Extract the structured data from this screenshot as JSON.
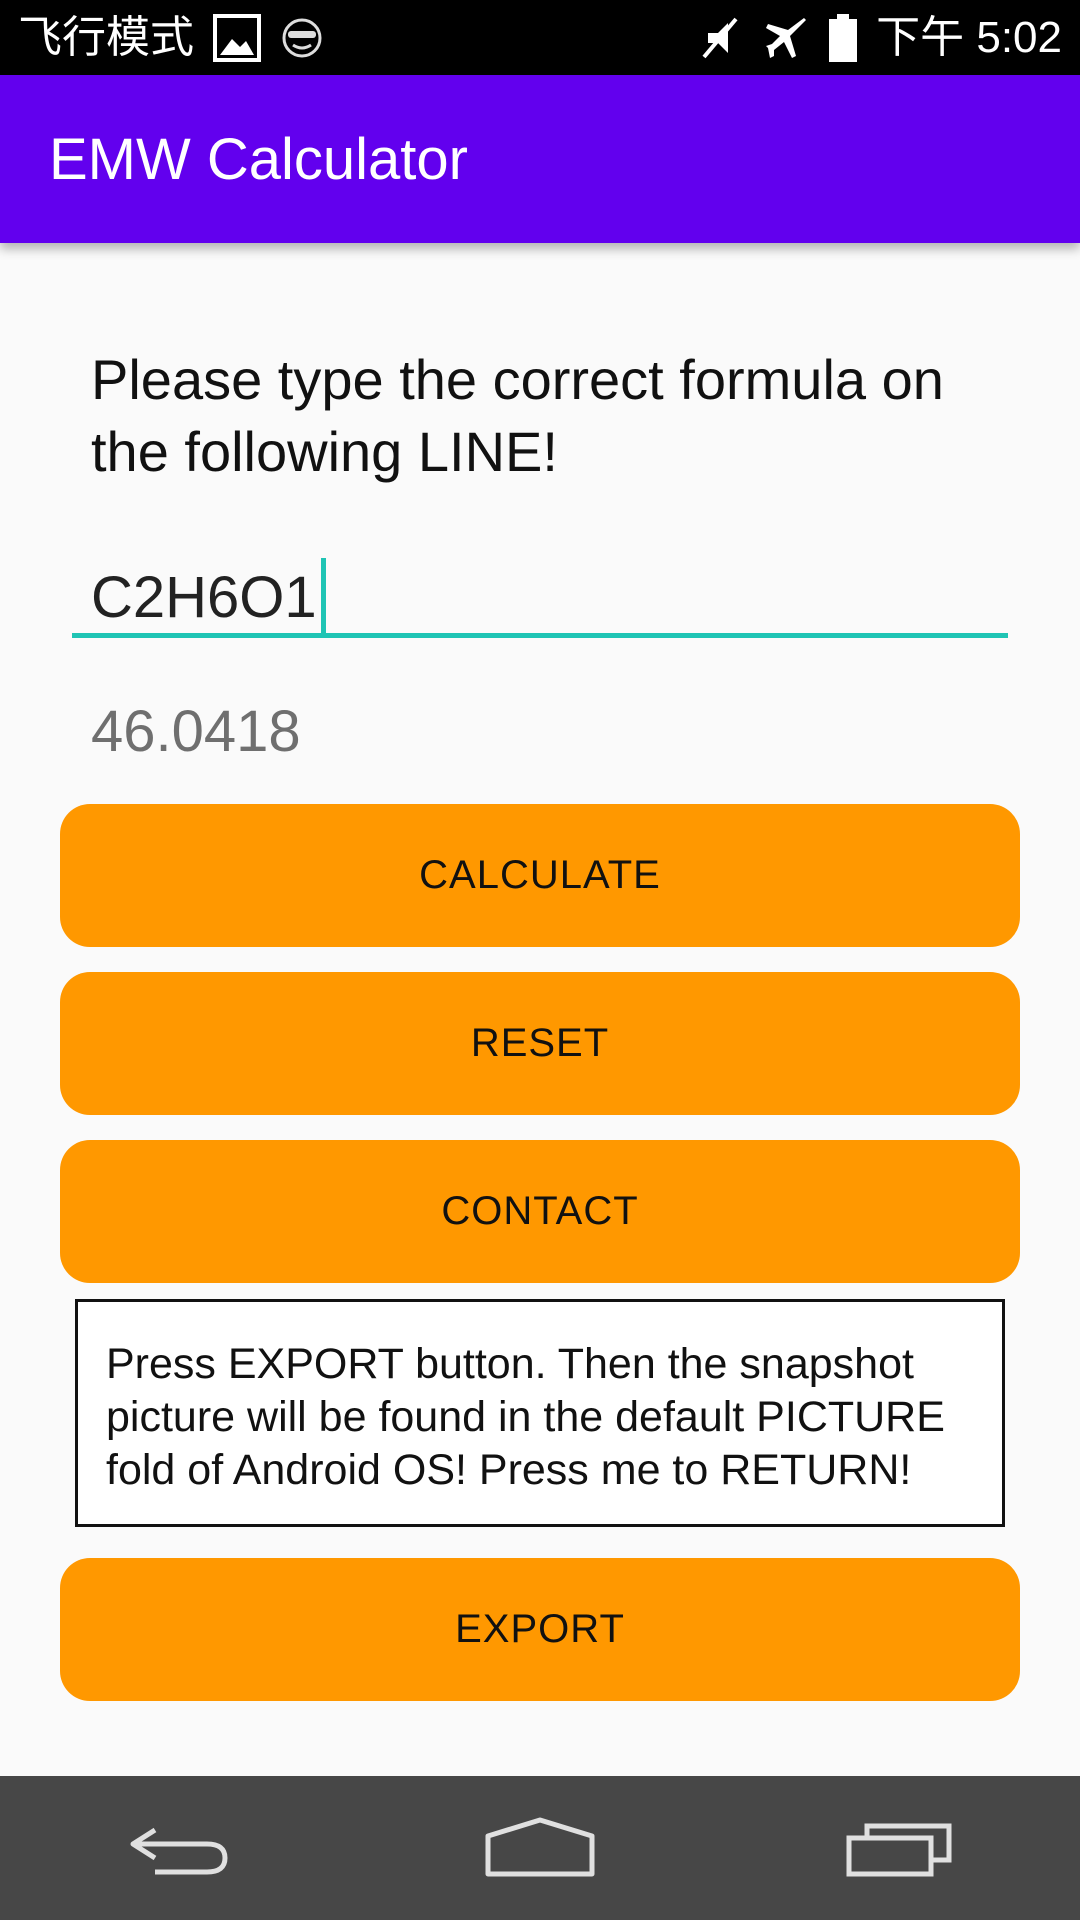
{
  "status_bar": {
    "left_text": "飞行模式",
    "image_icon": "image-icon",
    "emoji_icon": "sunglasses-face-icon",
    "mute_icon": "vibrate-off-icon",
    "airplane_icon": "airplane-icon",
    "battery_icon": "battery-icon",
    "time": "下午 5:02"
  },
  "app_bar": {
    "title": "EMW Calculator"
  },
  "main": {
    "instruction": "Please type the correct formula on the following LINE!",
    "formula_value": "C2H6O1",
    "result": "46.0418",
    "buttons": {
      "calculate": "CALCULATE",
      "reset": "RESET",
      "contact": "CONTACT",
      "export": "EXPORT"
    },
    "info": "Press EXPORT button. Then the snapshot picture will be found in the default PICTURE fold of Android OS! Press me to RETURN!"
  },
  "nav_bar": {
    "back_icon": "back-icon",
    "home_icon": "home-icon",
    "recents_icon": "recents-icon"
  },
  "colors": {
    "app_bar": "#6200ee",
    "button": "#ff9800",
    "accent": "#1fc4b4",
    "nav_bar": "#474747"
  }
}
